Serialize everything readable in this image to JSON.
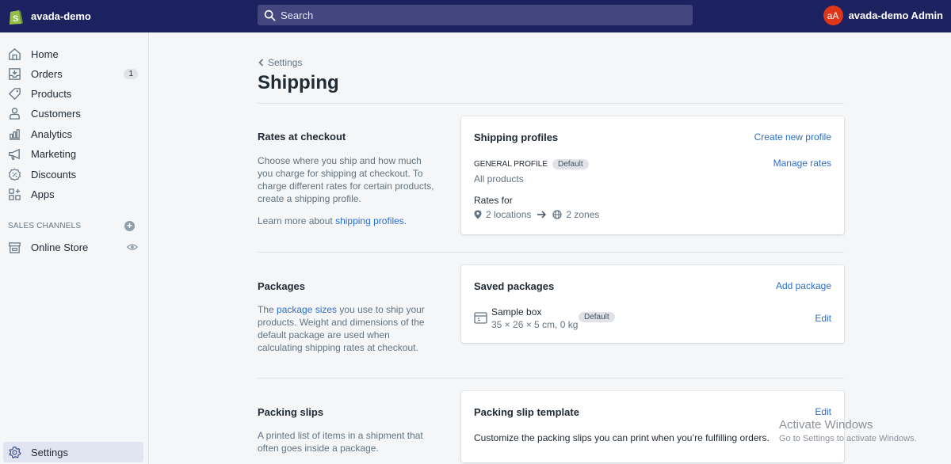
{
  "topbar": {
    "store_name": "avada-demo",
    "search_placeholder": "Search",
    "user_initials": "aA",
    "user_name": "avada-demo Admin"
  },
  "sidebar": {
    "items": [
      {
        "label": "Home",
        "icon": "home-icon"
      },
      {
        "label": "Orders",
        "icon": "orders-icon",
        "badge": "1"
      },
      {
        "label": "Products",
        "icon": "tag-icon"
      },
      {
        "label": "Customers",
        "icon": "customer-icon"
      },
      {
        "label": "Analytics",
        "icon": "analytics-icon"
      },
      {
        "label": "Marketing",
        "icon": "megaphone-icon"
      },
      {
        "label": "Discounts",
        "icon": "discount-icon"
      },
      {
        "label": "Apps",
        "icon": "apps-icon"
      }
    ],
    "sales_channels_title": "SALES CHANNELS",
    "channels": [
      {
        "label": "Online Store",
        "icon": "store-icon"
      }
    ],
    "settings_label": "Settings"
  },
  "page": {
    "breadcrumb": "Settings",
    "title": "Shipping"
  },
  "sections": {
    "rates": {
      "heading": "Rates at checkout",
      "description": "Choose where you ship and how much you charge for shipping at checkout. To charge different rates for certain products, create a shipping profile.",
      "learn_prefix": "Learn more about ",
      "learn_link": "shipping profiles",
      "learn_suffix": ".",
      "card": {
        "title": "Shipping profiles",
        "action": "Create new profile",
        "profile_name": "GENERAL PROFILE",
        "profile_badge": "Default",
        "profile_products": "All products",
        "manage_action": "Manage rates",
        "rates_for_label": "Rates for",
        "locations": "2 locations",
        "zones": "2 zones"
      }
    },
    "packages": {
      "heading": "Packages",
      "desc_prefix": "The ",
      "desc_link": "package sizes",
      "desc_suffix": " you use to ship your products. Weight and dimensions of the default package are used when calculating shipping rates at checkout.",
      "card": {
        "title": "Saved packages",
        "action": "Add package",
        "package_name": "Sample box",
        "package_dims": "35 × 26 × 5 cm, 0 kg",
        "package_badge": "Default",
        "edit_action": "Edit"
      }
    },
    "packing": {
      "heading": "Packing slips",
      "description": "A printed list of items in a shipment that often goes inside a package.",
      "card": {
        "title": "Packing slip template",
        "action": "Edit",
        "description": "Customize the packing slips you can print when you’re fulfilling orders."
      }
    }
  },
  "watermark": {
    "line1": "Activate Windows",
    "line2": "Go to Settings to activate Windows."
  },
  "colors": {
    "topbar": "#1c2260",
    "link": "#2c6ecb",
    "avatar": "#de3618"
  }
}
